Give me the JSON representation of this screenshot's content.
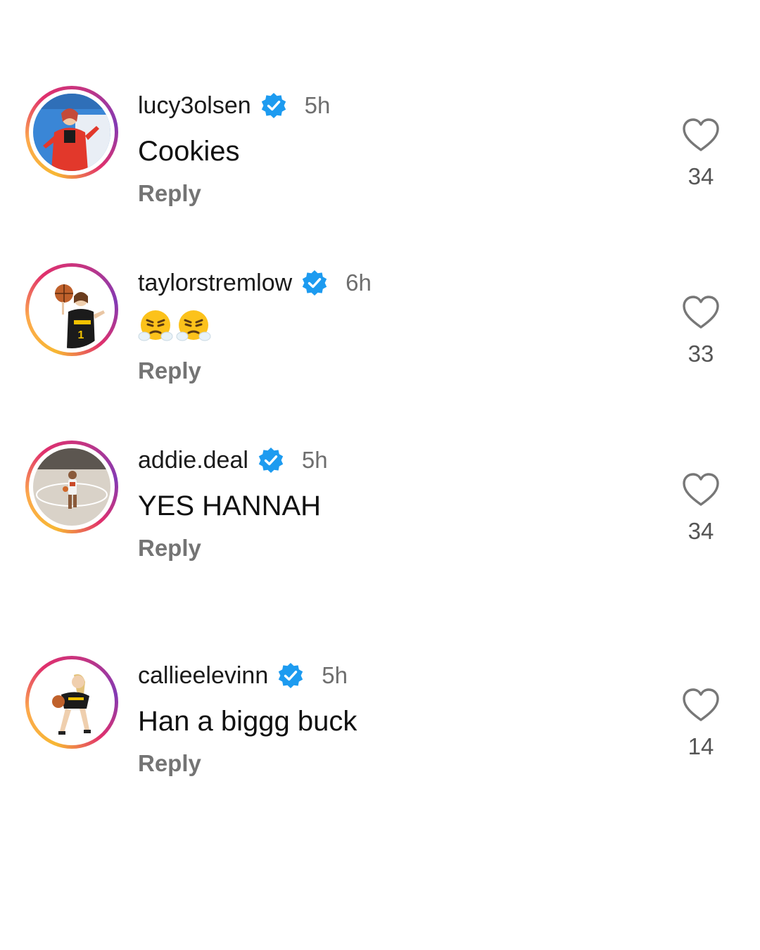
{
  "comments": [
    {
      "username": "lucy3olsen",
      "verified": true,
      "time": "5h",
      "text": "Cookies",
      "reply_label": "Reply",
      "likes": "34",
      "avatar_icon": "profile-photo-red-outfit"
    },
    {
      "username": "taylorstremlow",
      "verified": true,
      "time": "6h",
      "text": "😤😤",
      "emojis": [
        "face-with-steam-from-nose",
        "face-with-steam-from-nose"
      ],
      "reply_label": "Reply",
      "likes": "33",
      "avatar_icon": "profile-photo-basketball-player-spinning-ball"
    },
    {
      "username": "addie.deal",
      "verified": true,
      "time": "5h",
      "text": "YES HANNAH",
      "reply_label": "Reply",
      "likes": "34",
      "avatar_icon": "profile-photo-basketball-court"
    },
    {
      "username": "callieelevinn",
      "verified": true,
      "time": "5h",
      "text": "Han a biggg buck",
      "reply_label": "Reply",
      "likes": "14",
      "avatar_icon": "profile-photo-basketball-player-crouching"
    }
  ],
  "colors": {
    "verified_blue": "#1d9bf0",
    "username": "#1a1a1a",
    "meta_gray": "#6e6e6e",
    "reply_gray": "#747474",
    "heart_stroke": "#777777"
  }
}
